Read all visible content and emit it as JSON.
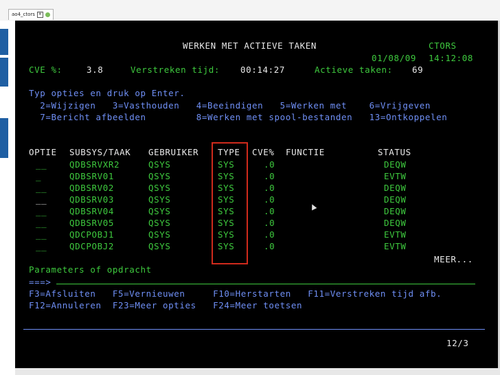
{
  "tab": {
    "label": "ao4_ctors"
  },
  "header": {
    "title": "WERKEN MET ACTIEVE TAKEN",
    "system": "CTORS",
    "date": "01/08/09",
    "time": "14:12:08"
  },
  "stats": {
    "cve_label": "CVE %:",
    "cve_value": "3.8",
    "elapsed_label": "Verstreken tijd:",
    "elapsed_value": "00:14:27",
    "active_label": "Actieve taken:",
    "active_value": "69"
  },
  "instructions": {
    "line1": "Typ opties en druk op Enter.",
    "line2": "  2=Wijzigen   3=Vasthouden   4=Beeindigen   5=Werken met    6=Vrijgeven",
    "line3": "  7=Bericht afbeelden         8=Werken met spool-bestanden   13=Ontkoppelen"
  },
  "table": {
    "columns": {
      "optie": "OPTIE",
      "subsys": "SUBSYS/TAAK",
      "gebruiker": "GEBRUIKER",
      "type": "TYPE",
      "cve": "CVE%",
      "functie": "FUNCTIE",
      "status": "STATUS"
    },
    "rows": [
      {
        "optie": "__",
        "subsys": "QDBSRVXR2",
        "gebruiker": "QSYS",
        "type": "SYS",
        "cve": ".0",
        "functie": "",
        "status": "DEQW"
      },
      {
        "optie": "_",
        "subsys": "QDBSRV01",
        "gebruiker": "QSYS",
        "type": "SYS",
        "cve": ".0",
        "functie": "",
        "status": "EVTW"
      },
      {
        "optie": "__",
        "subsys": "QDBSRV02",
        "gebruiker": "QSYS",
        "type": "SYS",
        "cve": ".0",
        "functie": "",
        "status": "DEQW"
      },
      {
        "optie": "__",
        "subsys": "QDBSRV03",
        "gebruiker": "QSYS",
        "type": "SYS",
        "cve": ".0",
        "functie": "",
        "status": "DEQW"
      },
      {
        "optie": "__",
        "subsys": "QDBSRV04",
        "gebruiker": "QSYS",
        "type": "SYS",
        "cve": ".0",
        "functie": "",
        "status": "DEQW"
      },
      {
        "optie": "__",
        "subsys": "QDBSRV05",
        "gebruiker": "QSYS",
        "type": "SYS",
        "cve": ".0",
        "functie": "",
        "status": "DEQW"
      },
      {
        "optie": "__",
        "subsys": "QDCPOBJ1",
        "gebruiker": "QSYS",
        "type": "SYS",
        "cve": ".0",
        "functie": "",
        "status": "EVTW"
      },
      {
        "optie": "__",
        "subsys": "QDCPOBJ2",
        "gebruiker": "QSYS",
        "type": "SYS",
        "cve": ".0",
        "functie": "",
        "status": "EVTW"
      }
    ],
    "more": "MEER..."
  },
  "params": {
    "label": "Parameters of opdracht",
    "prompt": "===>",
    "value": ""
  },
  "fkeys": {
    "line1": "F3=Afsluiten   F5=Vernieuwen     F10=Herstarten   F11=Verstreken tijd afb.",
    "line2": "F12=Annuleren  F23=Meer opties   F24=Meer toetsen"
  },
  "statusbar": {
    "position": "12/3"
  },
  "colors": {
    "screen_bg": "#000000",
    "green": "#3ec93e",
    "blue": "#6f8ff5",
    "white": "#e9e9e9",
    "cyan": "#30c0c0",
    "highlight": "#d02a1c",
    "tab_dot": "#7bbd5a",
    "side_blue": "#1f5fa3"
  }
}
